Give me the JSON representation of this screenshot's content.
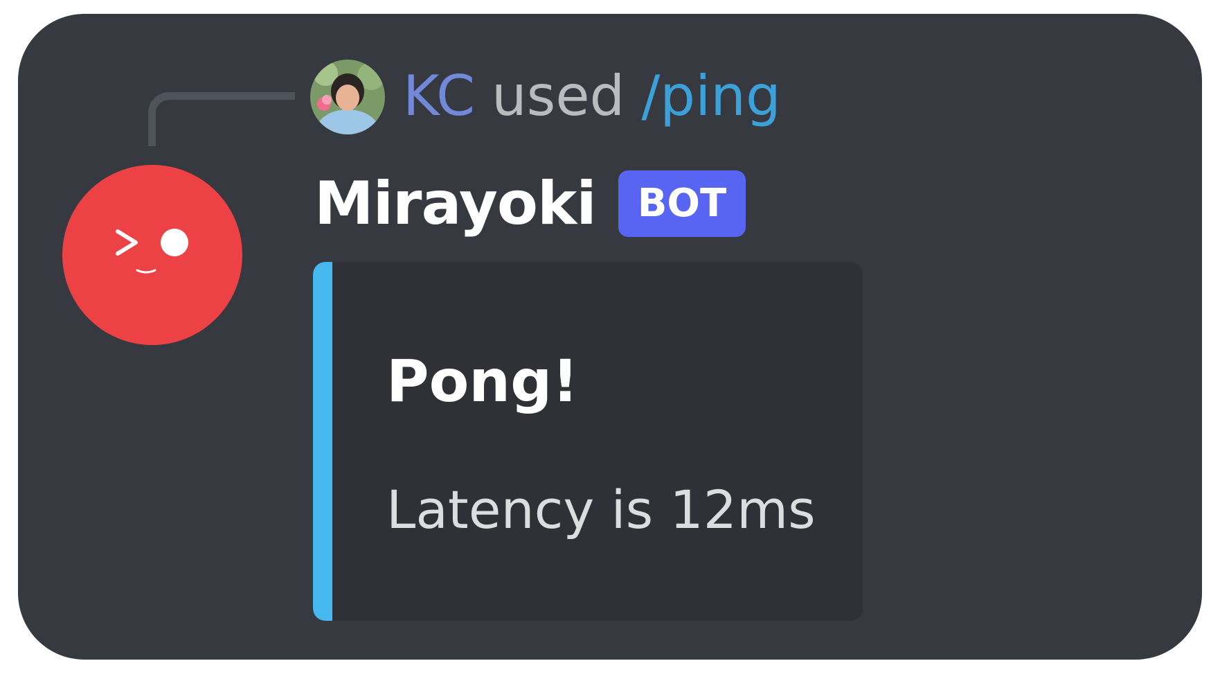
{
  "interaction": {
    "user": "KC",
    "verb": "used",
    "command": "/ping"
  },
  "message": {
    "author": "Mirayoki",
    "badge": "BOT"
  },
  "embed": {
    "title": "Pong!",
    "description": "Latency is 12ms"
  },
  "icons": {
    "user_avatar": "user-photo-avatar",
    "bot_avatar": "winking-face-avatar"
  },
  "colors": {
    "background": "#36393f",
    "embed_background": "#2f3136",
    "embed_accent": "#45b8f0",
    "bot_badge": "#5865f2",
    "bot_avatar": "#ed4245",
    "user_name": "#7289da",
    "command": "#3ba1d8"
  }
}
